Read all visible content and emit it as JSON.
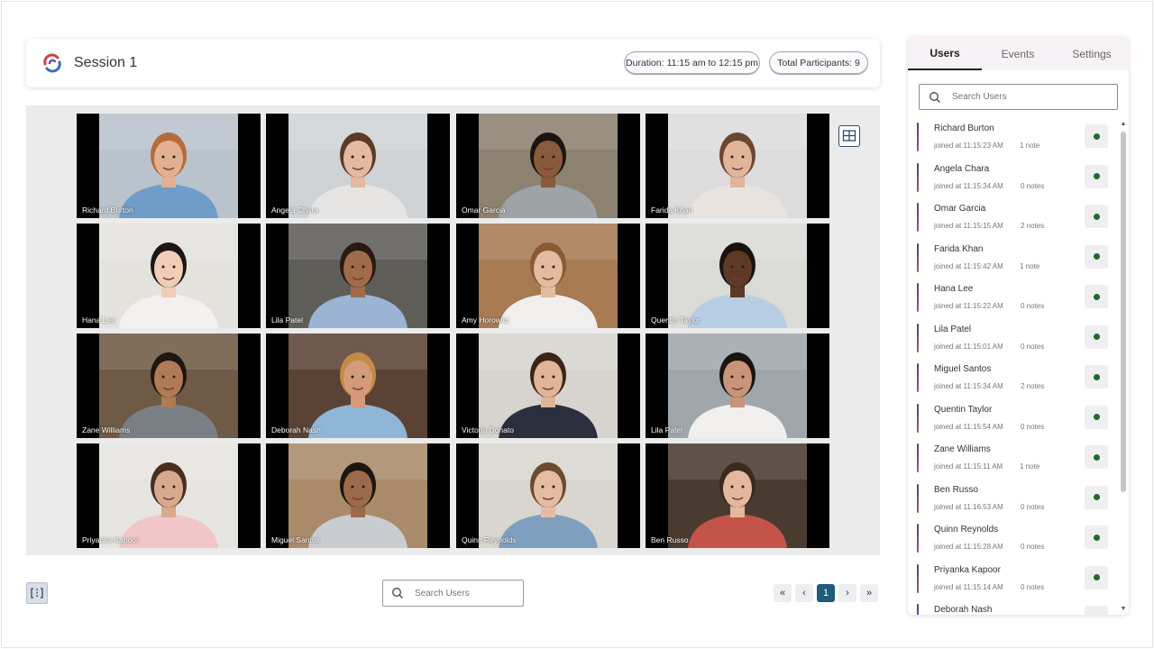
{
  "header": {
    "session_title": "Session 1",
    "duration": "Duration: 11:15 am to 12:15 pm",
    "total_participants": "Total Participants: 9"
  },
  "grid": {
    "tiles": [
      {
        "name": "Richard Burton",
        "skin": "#e2b193",
        "hair": "#b56b3a",
        "shirt": "#6f9cc8",
        "bg": "#b9c3cc"
      },
      {
        "name": "Angela Chara",
        "skin": "#e3b9a0",
        "hair": "#5b3a27",
        "shirt": "#e6e4e2",
        "bg": "#cfd3d6"
      },
      {
        "name": "Omar Garcia",
        "skin": "#8a5a3c",
        "hair": "#1d1410",
        "shirt": "#9ea3a6",
        "bg": "#8d8170"
      },
      {
        "name": "Farida Khan",
        "skin": "#e1b59a",
        "hair": "#6b4631",
        "shirt": "#e9e3df",
        "bg": "#dcdcdc"
      },
      {
        "name": "Hana Lee",
        "skin": "#f0cdb6",
        "hair": "#1c1714",
        "shirt": "#f2f1ef",
        "bg": "#e4e2dd"
      },
      {
        "name": "Lila Patel",
        "skin": "#a06b4a",
        "hair": "#2a1a12",
        "shirt": "#9bb4d3",
        "bg": "#5e5d58"
      },
      {
        "name": "Amy Horowitz",
        "skin": "#e3bba0",
        "hair": "#8a5a34",
        "shirt": "#f0efee",
        "bg": "#a77a52"
      },
      {
        "name": "Quentin Taylor",
        "skin": "#5c3a26",
        "hair": "#1a120d",
        "shirt": "#b6cde4",
        "bg": "#dadad6"
      },
      {
        "name": "Zane Williams",
        "skin": "#b07a55",
        "hair": "#1e1611",
        "shirt": "#7a7f86",
        "bg": "#6f5a45"
      },
      {
        "name": "Deborah Nash",
        "skin": "#d49a7a",
        "hair": "#c48b45",
        "shirt": "#8fb6d6",
        "bg": "#5a4334"
      },
      {
        "name": "Victoria Donato",
        "skin": "#e0b499",
        "hair": "#3b2418",
        "shirt": "#2b2f3d",
        "bg": "#d7d4cf"
      },
      {
        "name": "Lila Patel",
        "skin": "#c99479",
        "hair": "#1b1411",
        "shirt": "#f2f0ee",
        "bg": "#9fa7ad"
      },
      {
        "name": "Priyanka Kapoor",
        "skin": "#d7a98d",
        "hair": "#4a2f20",
        "shirt": "#f0c6c7",
        "bg": "#e6e4e0"
      },
      {
        "name": "Miguel Santos",
        "skin": "#9c6a4b",
        "hair": "#1d1510",
        "shirt": "#c9ccd0",
        "bg": "#a98a6a"
      },
      {
        "name": "Quinn Reynolds",
        "skin": "#e4bca4",
        "hair": "#6e4a2f",
        "shirt": "#7f9fbf",
        "bg": "#d9d6d0"
      },
      {
        "name": "Ben Russo",
        "skin": "#e3b89e",
        "hair": "#3c2a1e",
        "shirt": "#c4544a",
        "bg": "#4a3b30"
      }
    ]
  },
  "bottom": {
    "search_placeholder": "Search Users",
    "pager": {
      "first": "«",
      "prev": "‹",
      "current": "1",
      "next": "›",
      "last": "»"
    }
  },
  "side": {
    "tabs": [
      "Users",
      "Events",
      "Settings"
    ],
    "search_placeholder": "Search Users",
    "users": [
      {
        "name": "Richard Burton",
        "joined": "joined at 11:15:23 AM",
        "notes": "1 note"
      },
      {
        "name": "Angela Chara",
        "joined": "joined at 11:15:34 AM",
        "notes": "0 notes"
      },
      {
        "name": "Omar Garcia",
        "joined": "joined at 11:15:15 AM",
        "notes": "2 notes"
      },
      {
        "name": "Farida Khan",
        "joined": "joined at 11:15:42 AM",
        "notes": "1 note"
      },
      {
        "name": "Hana Lee",
        "joined": "joined at 11:15:22 AM",
        "notes": "0 notes"
      },
      {
        "name": "Lila Patel",
        "joined": "joined at 11:15:01 AM",
        "notes": "0 notes"
      },
      {
        "name": "Miguel Santos",
        "joined": "joined at 11:15:34 AM",
        "notes": "2 notes"
      },
      {
        "name": "Quentin Taylor",
        "joined": "joined at 11:15:54 AM",
        "notes": "0 notes"
      },
      {
        "name": "Zane Williams",
        "joined": "joined at 11:15:11 AM",
        "notes": "1 note"
      },
      {
        "name": "Ben Russo",
        "joined": "joined at 11:16:53 AM",
        "notes": "0 notes"
      },
      {
        "name": "Quinn Reynolds",
        "joined": "joined at 11:15:28 AM",
        "notes": "0 notes"
      },
      {
        "name": "Priyanka Kapoor",
        "joined": "joined at 11:15:14 AM",
        "notes": "0 notes"
      },
      {
        "name": "Deborah Nash",
        "joined": "",
        "notes": ""
      }
    ],
    "status_color": "#1f6a2b"
  },
  "icons": {
    "logo": "app-logo-icon",
    "layout": "grid-layout-icon",
    "sidebar_toggle": "sidebar-toggle-icon",
    "search": "search-icon"
  }
}
